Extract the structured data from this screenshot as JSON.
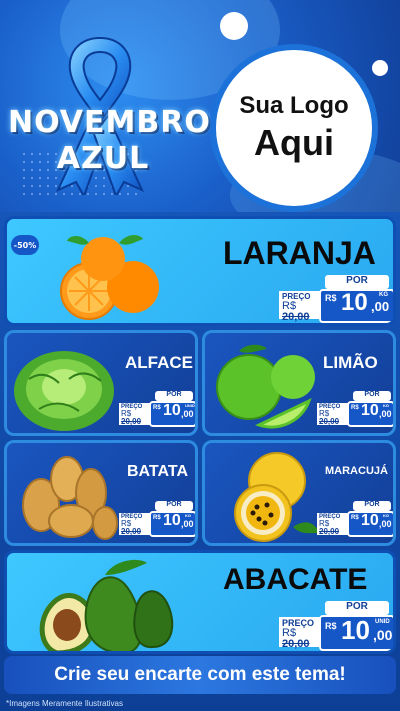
{
  "header": {
    "campaign_line1": "NOVEMBRO",
    "campaign_line2": "AZUL",
    "logo_line1": "Sua Logo",
    "logo_line2": "Aqui"
  },
  "discount_badge": "-50%",
  "products": [
    {
      "name": "LARANJA",
      "por": "POR",
      "preco_label": "PREÇO",
      "old_prefix": "R$",
      "old_price": "20,00",
      "new_prefix": "R$",
      "new_price_int": "10",
      "new_price_dec": ",00",
      "unit": "KG",
      "image": "orange-icon"
    },
    {
      "name": "ALFACE",
      "por": "POR",
      "preco_label": "PREÇO",
      "old_prefix": "R$",
      "old_price": "20,00",
      "new_prefix": "R$",
      "new_price_int": "10",
      "new_price_dec": ",00",
      "unit": "UNID",
      "image": "lettuce-icon"
    },
    {
      "name": "LIMÃO",
      "por": "POR",
      "preco_label": "PREÇO",
      "old_prefix": "R$",
      "old_price": "20,00",
      "new_prefix": "R$",
      "new_price_int": "10",
      "new_price_dec": ",00",
      "unit": "KG",
      "image": "lime-icon"
    },
    {
      "name": "BATATA",
      "por": "POR",
      "preco_label": "PREÇO",
      "old_prefix": "R$",
      "old_price": "20,00",
      "new_prefix": "R$",
      "new_price_int": "10",
      "new_price_dec": ",00",
      "unit": "KG",
      "image": "potato-icon"
    },
    {
      "name": "MARACUJÁ",
      "por": "POR",
      "preco_label": "PREÇO",
      "old_prefix": "R$",
      "old_price": "20,00",
      "new_prefix": "R$",
      "new_price_int": "10",
      "new_price_dec": ",00",
      "unit": "KG",
      "image": "passion-fruit-icon"
    },
    {
      "name": "ABACATE",
      "por": "POR",
      "preco_label": "PREÇO",
      "old_prefix": "R$",
      "old_price": "20,00",
      "new_prefix": "R$",
      "new_price_int": "10",
      "new_price_dec": ",00",
      "unit": "UNID",
      "image": "avocado-icon"
    }
  ],
  "cta": "Crie seu encarte com este tema!",
  "footer_note": "*Imagens Meramente Ilustrativas",
  "colors": {
    "primary": "#1657c8",
    "light_card": "#3ec8ff",
    "dark_card": "#123f98"
  }
}
